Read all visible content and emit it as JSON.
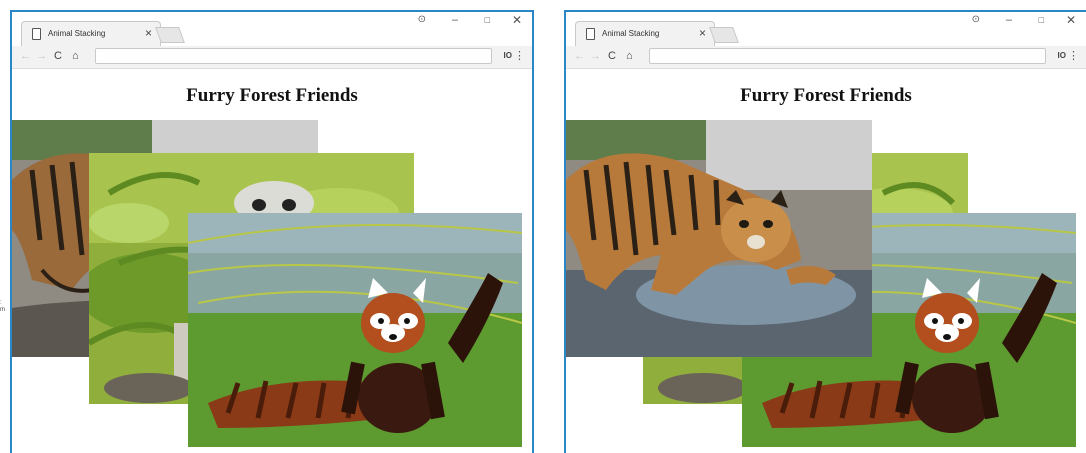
{
  "windows": [
    {
      "id": "left",
      "tab_title": "Animal Stacking",
      "tab_close": "×",
      "page_heading": "Furry Forest Friends",
      "front_photo": "red-panda"
    },
    {
      "id": "right",
      "tab_title": "Animal Stacking",
      "tab_close": "×",
      "page_heading": "Furry Forest Friends",
      "front_photo": "tiger-cub"
    }
  ],
  "controls": {
    "account": "⊙",
    "minimize": "–",
    "maximize": "□",
    "close": "✕",
    "back": "←",
    "forward": "→",
    "reload": "C",
    "home": "⌂",
    "extension": "IO",
    "menu": "⋮"
  },
  "photos": {
    "tiger": "tiger-cub",
    "lemur": "ring-tailed-lemur",
    "panda": "red-panda"
  },
  "colors": {
    "window_border": "#2b86c5",
    "tab_bg": "#f2f2f2",
    "toolbar_bg": "#f2f2f2"
  }
}
